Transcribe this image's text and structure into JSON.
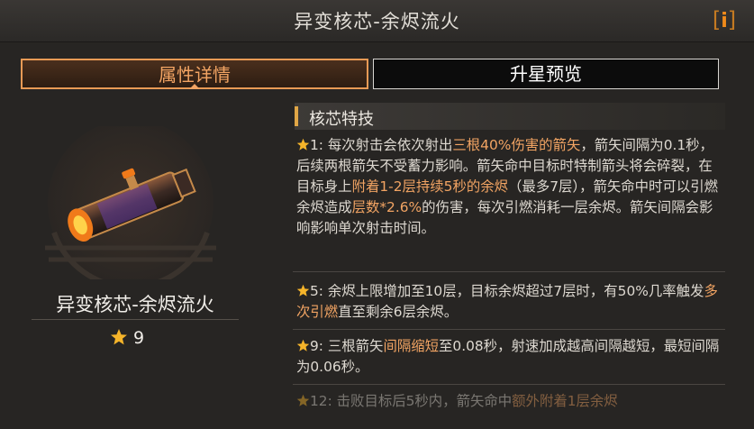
{
  "header": {
    "title": "异变核芯-余烬流火",
    "info_label": "i"
  },
  "tabs": [
    {
      "label": "属性详情",
      "active": true
    },
    {
      "label": "升星预览",
      "active": false
    }
  ],
  "item": {
    "name": "异变核芯-余烬流火",
    "star_level": "9"
  },
  "section": {
    "title": "核芯特技"
  },
  "entries": [
    {
      "level": "1",
      "segments": [
        {
          "text": "1: 每次射击会依次射出",
          "hl": false
        },
        {
          "text": "三根40%伤害的箭矢",
          "hl": true
        },
        {
          "text": "，箭矢间隔为0.1秒，后续两根箭矢不受蓄力影响。箭矢命中目标时特制箭头将会碎裂，在目标身上",
          "hl": false
        },
        {
          "text": "附着1-2层持续5秒的余烬",
          "hl": true
        },
        {
          "text": "（最多7层），箭矢命中时可以引燃余烬造成",
          "hl": false
        },
        {
          "text": "层数*2.6%",
          "hl": true
        },
        {
          "text": "的伤害，每次引燃消耗一层余烬。箭矢间隔会影响影响单次射击时间。",
          "hl": false
        }
      ]
    },
    {
      "level": "5",
      "segments": [
        {
          "text": "5: 余烬上限增加至10层，目标余烬超过7层时，有50%几率触发",
          "hl": false
        },
        {
          "text": "多次引燃",
          "hl": true
        },
        {
          "text": "直至剩余6层余烬。",
          "hl": false
        }
      ]
    },
    {
      "level": "9",
      "segments": [
        {
          "text": "9: 三根箭矢",
          "hl": false
        },
        {
          "text": "间隔缩短",
          "hl": true
        },
        {
          "text": "至0.08秒，射速加成越高间隔越短，最短间隔为0.06秒。",
          "hl": false
        }
      ]
    },
    {
      "level": "12",
      "segments": [
        {
          "text": "12: 击败目标后5秒内，箭矢命中",
          "hl": false
        },
        {
          "text": "额外附着1层余烬",
          "hl": true
        }
      ]
    }
  ],
  "colors": {
    "accent": "#f2a463",
    "star": "#f5b42a",
    "background": "#272523"
  }
}
